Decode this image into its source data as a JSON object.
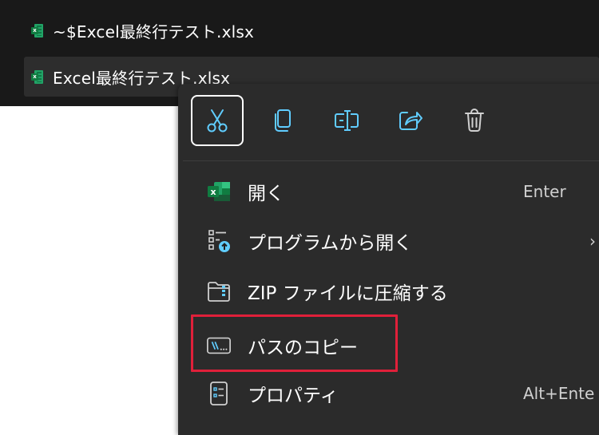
{
  "files": [
    {
      "name": "~$Excel最終行テスト.xlsx",
      "icon": "excel-file-icon",
      "selected": false
    },
    {
      "name": "Excel最終行テスト.xlsx",
      "icon": "excel-file-icon",
      "selected": true
    }
  ],
  "quick_actions": [
    {
      "name": "cut",
      "icon": "scissors-icon"
    },
    {
      "name": "copy",
      "icon": "copy-icon"
    },
    {
      "name": "rename",
      "icon": "rename-icon"
    },
    {
      "name": "share",
      "icon": "share-icon"
    },
    {
      "name": "delete",
      "icon": "trash-icon"
    }
  ],
  "menu": {
    "open": {
      "label": "開く",
      "shortcut": "Enter",
      "icon": "excel-app-icon"
    },
    "open_with": {
      "label": "プログラムから開く",
      "arrow": "›",
      "icon": "open-with-icon"
    },
    "zip": {
      "label": "ZIP ファイルに圧縮する",
      "icon": "zip-folder-icon"
    },
    "copy_path": {
      "label": "パスのコピー",
      "icon": "copy-path-icon"
    },
    "properties": {
      "label": "プロパティ",
      "shortcut": "Alt+Ente",
      "icon": "properties-icon"
    }
  },
  "colors": {
    "menu_bg": "#2b2b2b",
    "explorer_bg": "#191919",
    "highlight_box": "#e0203a",
    "accent_blue": "#60cdff",
    "excel_green": "#107c41"
  }
}
